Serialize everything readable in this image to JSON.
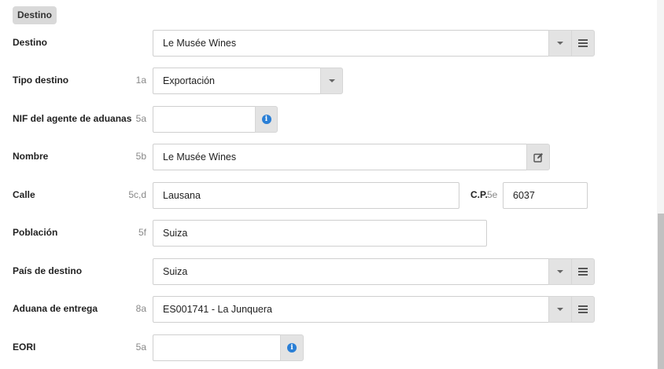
{
  "section": {
    "title": "Destino"
  },
  "fields": {
    "destino": {
      "label": "Destino",
      "code": "",
      "value": "Le Musée Wines"
    },
    "tipo_destino": {
      "label": "Tipo destino",
      "code": "1a",
      "value": "Exportación"
    },
    "nif_agente": {
      "label": "NIF del agente de aduanas",
      "code": "5a",
      "value": ""
    },
    "nombre": {
      "label": "Nombre",
      "code": "5b",
      "value": "Le Musée Wines"
    },
    "calle": {
      "label": "Calle",
      "code": "5c,d",
      "value": "Lausana"
    },
    "cp": {
      "label": "C.P.",
      "code": "5e",
      "value": "6037"
    },
    "poblacion": {
      "label": "Población",
      "code": "5f",
      "value": "Suiza"
    },
    "pais_destino": {
      "label": "País de destino",
      "code": "",
      "value": "Suiza"
    },
    "aduana_entrega": {
      "label": "Aduana de entrega",
      "code": "8a",
      "value": "ES001741 - La Junquera"
    },
    "eori": {
      "label": "EORI",
      "code": "5a",
      "value": ""
    }
  },
  "icons": {
    "dropdown": "chevron-down-icon",
    "list": "list-icon",
    "info": "info-icon",
    "edit": "edit-icon"
  },
  "colors": {
    "info_blue": "#2a7fd6",
    "addon_bg": "#e3e3e3",
    "tag_bg": "#d9d9d9"
  }
}
